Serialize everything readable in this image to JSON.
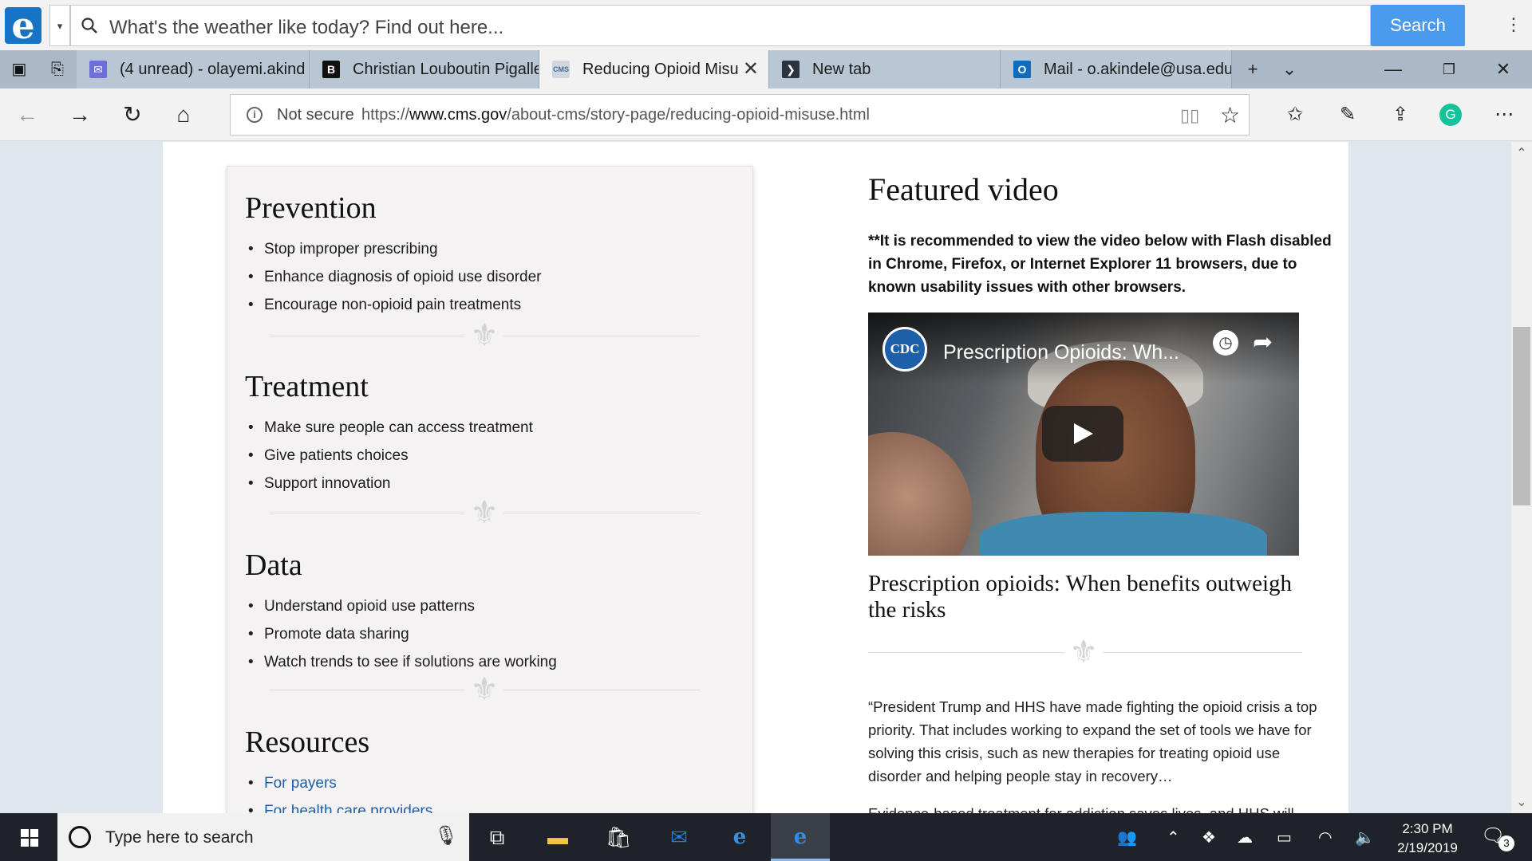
{
  "search": {
    "placeholder": "What's the weather like today? Find out here...",
    "button": "Search"
  },
  "tabs": [
    {
      "label": "(4 unread) - olayemi.akind",
      "icon": "mail-icon"
    },
    {
      "label": "Christian Louboutin Pigalle",
      "icon": "b-site-icon"
    },
    {
      "label": "Reducing Opioid Misu",
      "icon": "cms-icon",
      "active": true
    },
    {
      "label": "New tab",
      "icon": "newtab-icon"
    },
    {
      "label": "Mail - o.akindele@usa.edu",
      "icon": "outlook-icon"
    }
  ],
  "address": {
    "security": "Not secure",
    "url_prefix": "https://",
    "url_domain": "www.cms.gov",
    "url_path": "/about-cms/story-page/reducing-opioid-misuse.html"
  },
  "sections": [
    {
      "title": "Prevention",
      "items": [
        "Stop improper prescribing",
        "Enhance diagnosis of opioid use disorder",
        "Encourage non-opioid pain treatments"
      ]
    },
    {
      "title": "Treatment",
      "items": [
        "Make sure people can access treatment",
        "Give patients choices",
        "Support innovation"
      ]
    },
    {
      "title": "Data",
      "items": [
        "Understand opioid use patterns",
        "Promote data sharing",
        "Watch trends to see if solutions are working"
      ]
    },
    {
      "title": "Resources",
      "items": [
        "For payers",
        "For health care providers"
      ]
    }
  ],
  "featured": {
    "title": "Featured video",
    "note": "**It is recommended to view the video below with Flash disabled in Chrome, Firefox, or Internet Explorer 11 browsers, due to known usability issues with other browsers.",
    "video_logo": "CDC",
    "video_title": "Prescription Opioids: Wh...",
    "caption": "Prescription opioids: When benefits outweigh the risks",
    "quote": "“President Trump and HHS have made fighting the opioid crisis a top priority. That includes working to expand the set of tools we have for solving this crisis, such as new therapies for treating opioid use disorder and helping people stay in recovery…",
    "quote_next": "Evidence-based treatment for addiction saves lives, and HHS will"
  },
  "taskbar": {
    "search_placeholder": "Type here to search",
    "time": "2:30 PM",
    "date": "2/19/2019",
    "notification_count": "3"
  },
  "colors": {
    "accent": "#4a9bee",
    "link": "#1f5fa8",
    "card_bg": "#f4f2f2"
  }
}
